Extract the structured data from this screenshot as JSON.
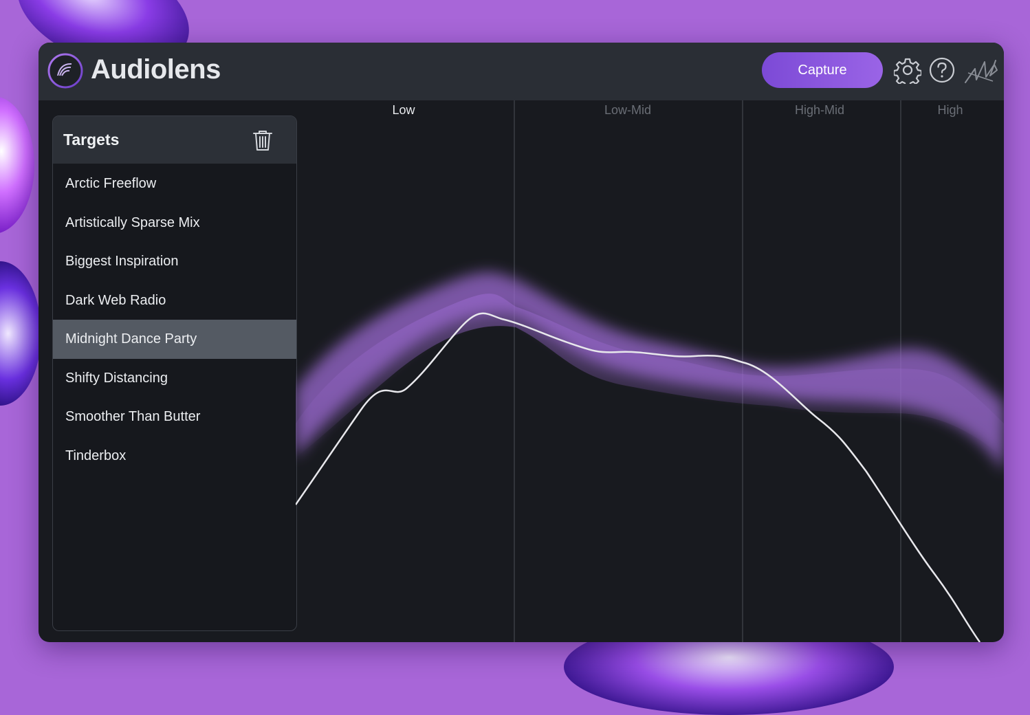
{
  "app": {
    "title": "Audiolens"
  },
  "header": {
    "capture_label": "Capture",
    "icons": [
      "logo-icon",
      "gear-icon",
      "help-icon",
      "brand-icon"
    ]
  },
  "targets": {
    "title": "Targets",
    "selected_index": 4,
    "items": [
      {
        "label": "Arctic Freeflow"
      },
      {
        "label": "Artistically Sparse Mix"
      },
      {
        "label": "Biggest Inspiration"
      },
      {
        "label": "Dark Web Radio"
      },
      {
        "label": "Midnight Dance Party"
      },
      {
        "label": "Shifty Distancing"
      },
      {
        "label": "Smoother Than Butter"
      },
      {
        "label": "Tinderbox"
      }
    ]
  },
  "graph": {
    "bands": [
      {
        "label": "Low",
        "active": true
      },
      {
        "label": "Low-Mid",
        "active": false
      },
      {
        "label": "High-Mid",
        "active": false
      },
      {
        "label": "High",
        "active": false
      }
    ]
  },
  "colors": {
    "accent": "#8a56de",
    "window_bg": "#181a1f",
    "header_bg": "#2a2e35",
    "selected_row": "#545a63",
    "target_band": "#9b6ad0",
    "capture_line": "#e8e8ec"
  }
}
